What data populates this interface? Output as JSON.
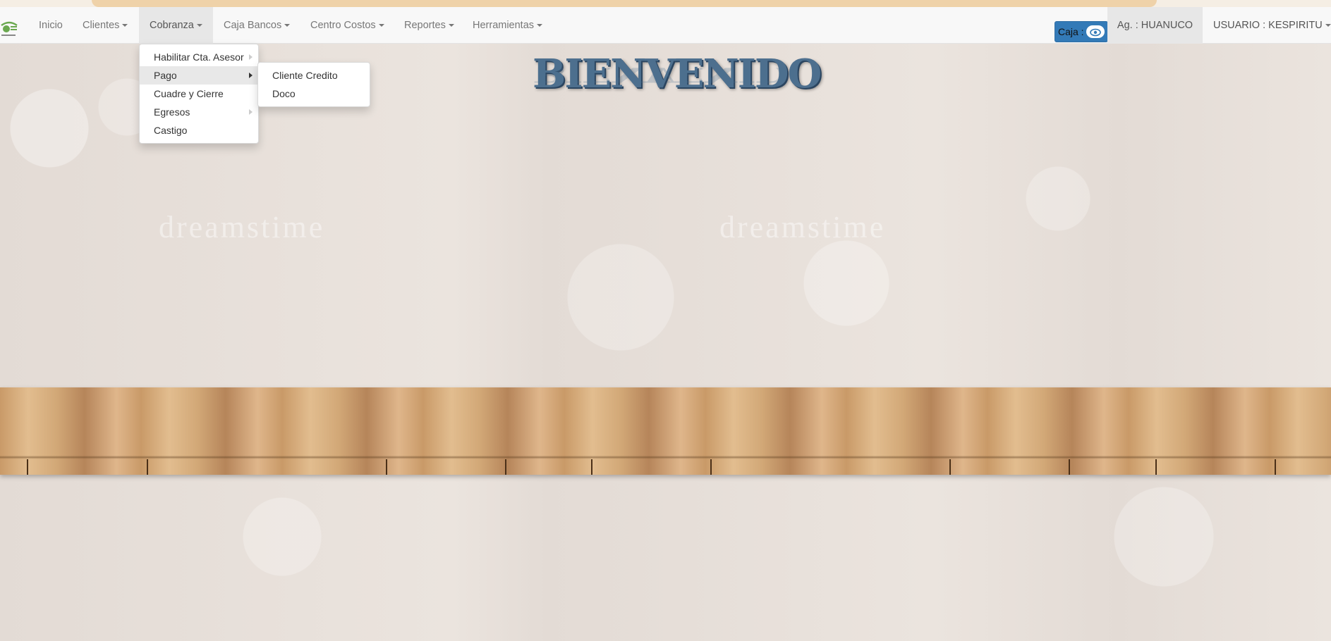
{
  "navbar": {
    "items": [
      {
        "label": "Inicio",
        "has_caret": false
      },
      {
        "label": "Clientes",
        "has_caret": true
      },
      {
        "label": "Cobranza",
        "has_caret": true
      },
      {
        "label": "Caja Bancos",
        "has_caret": true
      },
      {
        "label": "Centro Costos",
        "has_caret": true
      },
      {
        "label": "Reportes",
        "has_caret": true
      },
      {
        "label": "Herramientas",
        "has_caret": true
      }
    ],
    "active_item": "Cobranza",
    "caja_label": "Caja :",
    "caja_icon": "eye-icon",
    "agency": "Ag. : HUANUCO",
    "user": "USUARIO : KESPIRITU"
  },
  "cobranza_menu": {
    "items": [
      {
        "label": "Habilitar Cta. Asesor",
        "has_submenu": true
      },
      {
        "label": "Pago",
        "has_submenu": true
      },
      {
        "label": "Cuadre y Cierre",
        "has_submenu": false
      },
      {
        "label": "Egresos",
        "has_submenu": true
      },
      {
        "label": "Castigo",
        "has_submenu": false
      }
    ],
    "highlighted": "Pago"
  },
  "pago_submenu": {
    "items": [
      {
        "label": "Cliente Credito"
      },
      {
        "label": "Doco"
      }
    ]
  },
  "main": {
    "welcome_title": "BIENVENIDO",
    "watermark_text": "dreamstime"
  },
  "colors": {
    "caja_button": "#337ab7",
    "title": "#4d6f8e",
    "navbar_bg": "#f8f8f8"
  }
}
